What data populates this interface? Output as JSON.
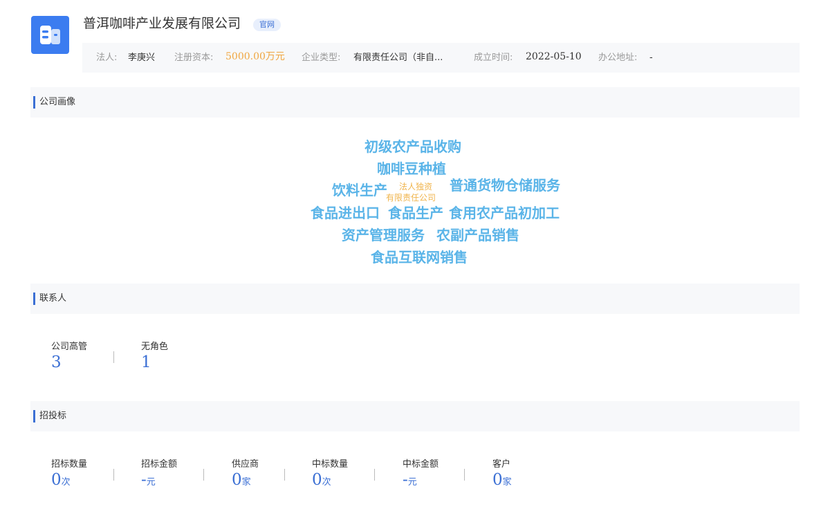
{
  "company": {
    "name": "普洱咖啡产业发展有限公司",
    "badge": "官网"
  },
  "info": {
    "legal_rep_label": "法人:",
    "legal_rep_value": "李庚兴",
    "capital_label": "注册资本:",
    "capital_value": "5000.00万元",
    "type_label": "企业类型:",
    "type_value": "有限责任公司（非自...",
    "founded_label": "成立时间:",
    "founded_value": "2022-05-10",
    "address_label": "办公地址:",
    "address_value": "-"
  },
  "sections": {
    "portrait": "公司画像",
    "contacts": "联系人",
    "bidding": "招投标"
  },
  "word_cloud": [
    "初级农产品收购",
    "咖啡豆种植",
    "饮料生产",
    "法人独资",
    "有限责任公司",
    "普通货物仓储服务",
    "食品进出口",
    "食品生产",
    "食用农产品初加工",
    "资产管理服务",
    "农副产品销售",
    "食品互联网销售"
  ],
  "contacts": [
    {
      "label": "公司高管",
      "value": "3"
    },
    {
      "label": "无角色",
      "value": "1"
    }
  ],
  "bidding": [
    {
      "label": "招标数量",
      "value": "0",
      "unit": "次"
    },
    {
      "label": "招标金额",
      "value": "-",
      "unit": "元"
    },
    {
      "label": "供应商",
      "value": "0",
      "unit": "家"
    },
    {
      "label": "中标数量",
      "value": "0",
      "unit": "次"
    },
    {
      "label": "中标金额",
      "value": "-",
      "unit": "元"
    },
    {
      "label": "客户",
      "value": "0",
      "unit": "家"
    }
  ],
  "colors": {
    "accent": "#3b6fd4",
    "logo": "#3b7cf0",
    "cloud_primary": "#5ab4e8",
    "cloud_secondary": "#f0b44c",
    "capital": "#f0a640"
  },
  "icons": {
    "logo": "building-icon"
  }
}
